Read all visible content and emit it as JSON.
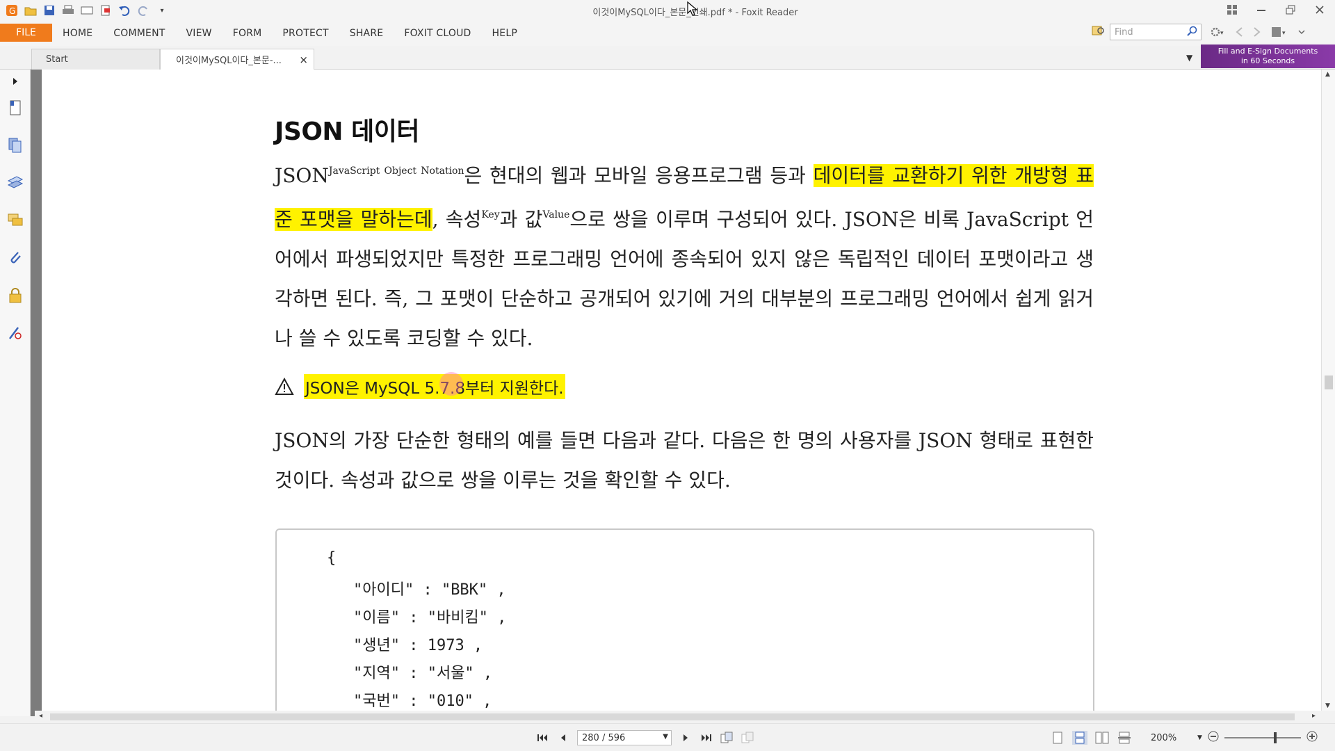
{
  "window": {
    "title": "이것이MySQL이다_본문_인쇄.pdf * - Foxit Reader"
  },
  "ribbon": {
    "file_label": "FILE",
    "tabs": [
      "HOME",
      "COMMENT",
      "VIEW",
      "FORM",
      "PROTECT",
      "SHARE",
      "FOXIT CLOUD",
      "HELP"
    ],
    "find_placeholder": "Find"
  },
  "doc_tabs": {
    "start_label": "Start",
    "doc_label": "이것이MySQL이다_본문-...",
    "close_glyph": "×"
  },
  "ad": {
    "line1": "Fill and E-Sign Documents",
    "line2": "in 60 Seconds"
  },
  "content": {
    "heading": "JSON 데이터",
    "p1": {
      "s1": "JSON",
      "s1_sup": "JavaScript Object Notation",
      "s2": "은 현대의 웹과 모바일 응용프로그램 등과 ",
      "s3_hl": "데이터를 교환하기 위한 개방형 표준 포맷을 말하는데",
      "s4": ", 속성",
      "s4_sup": "Key",
      "s5": "과 값",
      "s5_sup": "Value",
      "s6": "으로 쌍을 이루며 구성되어 있다. JSON은 비록 JavaScript 언어에서 파생되었지만 특정한 프로그래밍 언어에 종속되어 있지 않은 독립적인 데이터 포맷이라고 생각하면 된다. 즉, 그 포맷이 단순하고 공개되어 있기에 거의 대부분의 프로그래밍 언어에서 쉽게 읽거나 쓸 수 있도록 코딩할 수 있다."
    },
    "warning": "JSON은 MySQL 5.7.8부터 지원한다.",
    "p2": "JSON의 가장 단순한 형태의 예를 들면 다음과 같다. 다음은 한 명의 사용자를 JSON 형태로 표현한 것이다. 속성과 값으로 쌍을 이루는 것을 확인할 수 있다.",
    "code": {
      "open": "{",
      "lines": [
        "\"아이디\" : \"BBK\" ,",
        "\"이름\" : \"바비킴\" ,",
        "\"생년\" : 1973 ,",
        "\"지역\" : \"서울\" ,",
        "\"국번\" : \"010\" ,"
      ]
    }
  },
  "status": {
    "page": "280 / 596",
    "zoom": "200%",
    "zoom_level": 0.65
  },
  "colors": {
    "file_button": "#f07b1c",
    "highlight": "#fff200",
    "ad_banner": "#7a3298"
  }
}
